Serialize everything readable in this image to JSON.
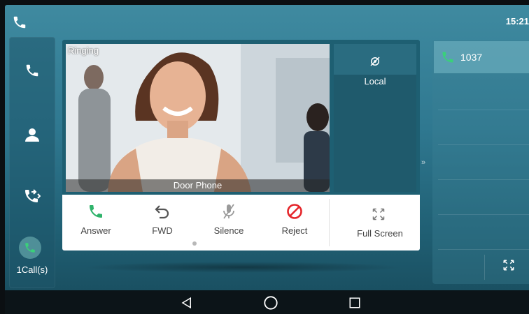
{
  "status_bar": {
    "time": "15:21",
    "icon": "phone-icon"
  },
  "sidebar": {
    "items": [
      {
        "name": "phone-icon"
      },
      {
        "name": "contacts-icon"
      },
      {
        "name": "call-forward-icon"
      }
    ],
    "calls_label": "1Call(s)"
  },
  "video": {
    "status": "Ringing",
    "caller_label": "Door Phone",
    "local_label": "Local"
  },
  "controls": {
    "answer": "Answer",
    "fwd": "FWD",
    "silence": "Silence",
    "reject": "Reject",
    "full_screen": "Full Screen"
  },
  "call_list": {
    "items": [
      {
        "number": "1037",
        "active": true
      }
    ]
  },
  "colors": {
    "answer_green": "#2fb36b",
    "reject_red": "#e5262b",
    "background_teal": "#2f7890"
  },
  "nav": {
    "back": "back-icon",
    "home": "home-icon",
    "recents": "recents-icon"
  }
}
